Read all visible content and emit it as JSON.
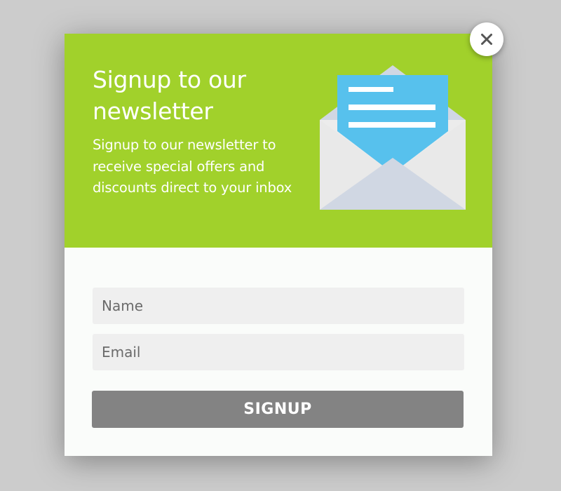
{
  "popup": {
    "title": "Signup to our newsletter",
    "description": "Signup to our newsletter to receive special offers and discounts direct to your inbox",
    "icon": "envelope-letter-icon",
    "close_icon": "close-icon"
  },
  "form": {
    "name_placeholder": "Name",
    "email_placeholder": "Email",
    "submit_label": "SIGNUP"
  },
  "colors": {
    "header_background": "#a1d12b",
    "button_background": "#838383",
    "input_background": "#efefef",
    "letter_blue": "#57c1ed",
    "envelope_body": "#ececec",
    "envelope_shade": "#d0d7e3",
    "backdrop": "#cccccc"
  }
}
